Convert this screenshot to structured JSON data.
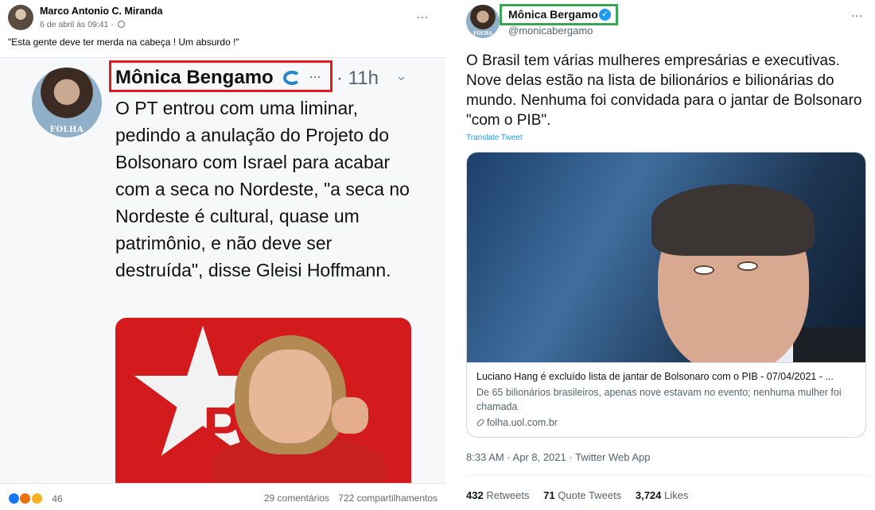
{
  "facebook": {
    "author_name": "Marco Antonio C. Miranda",
    "timestamp": "6 de abril às 09:41 · ",
    "caption": "\"Esta gente deve ter merda na cabeça ! Um absurdo !\"",
    "more_icon": "…",
    "screenshot": {
      "author_name": "Mônica Bengamo",
      "avatar_label": "FOLHA",
      "ellipsis": "…",
      "time": "· 11h",
      "text": "O PT entrou com uma liminar, pedindo a anulação do Projeto do Bolsonaro com Israel para acabar com a seca no Nordeste, \"a seca no Nordeste é cultural, quase um patrimônio, e não deve ser destruída\", disse Gleisi Hoffmann.",
      "highlight_color": "#e51b24"
    },
    "reactions_count": "46",
    "comments": "29 comentários",
    "shares": "722 compartilhamentos"
  },
  "twitter": {
    "display_name": "Mônica Bergamo",
    "handle": "@monicabergamo",
    "avatar_label": "FOLHA",
    "verified_mark": "✓",
    "more_icon": "…",
    "text": "O Brasil tem várias mulheres empresárias e executivas. Nove delas estão na lista de bilionários e bilionárias do mundo. Nenhuma foi convidada para o jantar de Bolsonaro \"com o PIB\".",
    "translate": "Translate Tweet",
    "card": {
      "title": "Luciano Hang é excluído lista de jantar de Bolsonaro com o PIB - 07/04/2021 - ...",
      "description": "De 65 bilionários brasileiros, apenas nove estavam no evento; nenhuma mulher foi chamada",
      "domain": "folha.uol.com.br"
    },
    "timestamp": "8:33 AM · Apr 8, 2021 · Twitter Web App",
    "retweets_count": "432",
    "retweets_label": "Retweets",
    "quote_count": "71",
    "quote_label": "Quote Tweets",
    "likes_count": "3,724",
    "likes_label": "Likes",
    "highlight_color": "#3aa757",
    "accent": "#1d9bf0"
  }
}
